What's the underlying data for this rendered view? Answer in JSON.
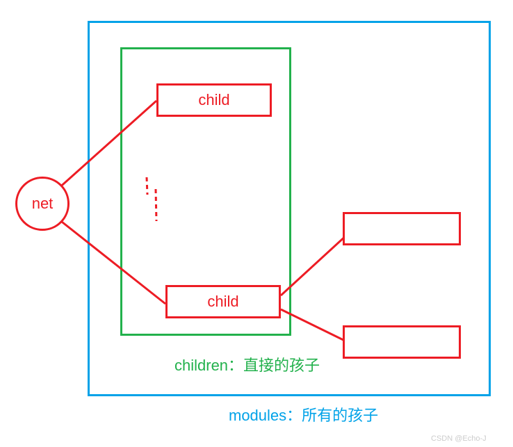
{
  "root": {
    "label": "net"
  },
  "children": {
    "label": "children：直接的孩子",
    "nodes": [
      {
        "label": "child"
      },
      {
        "label": "child"
      }
    ]
  },
  "modules": {
    "label": "modules：所有的孩子"
  },
  "watermark": "CSDN @Echo-J"
}
